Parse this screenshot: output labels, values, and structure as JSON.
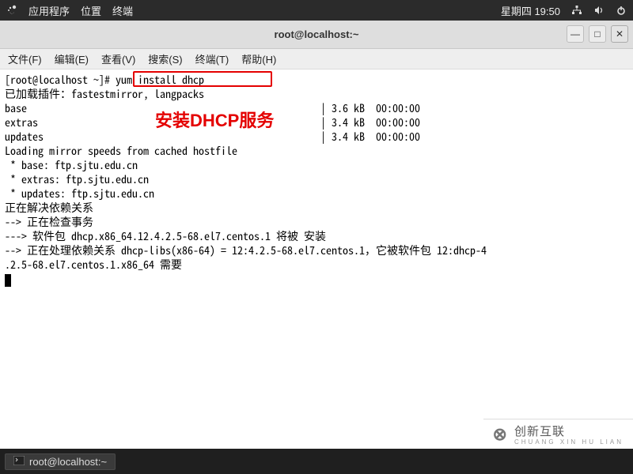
{
  "topbar": {
    "apps": "应用程序",
    "places": "位置",
    "terminal": "终端",
    "clock": "星期四 19:50"
  },
  "window": {
    "title": "root@localhost:~",
    "btn_min": "—",
    "btn_max": "□",
    "btn_close": "✕"
  },
  "menu": {
    "file": "文件(F)",
    "edit": "编辑(E)",
    "view": "查看(V)",
    "search": "搜索(S)",
    "terminal": "终端(T)",
    "help": "帮助(H)"
  },
  "term": {
    "prompt": "[root@localhost ~]# ",
    "cmd": "yum install dhcp",
    "line2": "已加载插件：fastestmirror, langpacks",
    "line3": "base                                                     | 3.6 kB  00:00:00",
    "line4": "extras                                                   | 3.4 kB  00:00:00",
    "line5": "updates                                                  | 3.4 kB  00:00:00",
    "line6": "Loading mirror speeds from cached hostfile",
    "line7": " * base: ftp.sjtu.edu.cn",
    "line8": " * extras: ftp.sjtu.edu.cn",
    "line9": " * updates: ftp.sjtu.edu.cn",
    "line10": "正在解决依赖关系",
    "line11": "--> 正在检查事务",
    "line12": "---> 软件包 dhcp.x86_64.12.4.2.5-68.el7.centos.1 将被 安装",
    "line13a": "--> 正在处理依赖关系 dhcp-libs(x86-64) = 12:4.2.5-68.el7.centos.1，它被软件包 12:dhcp-4",
    "line13b": ".2.5-68.el7.centos.1.x86_64 需要"
  },
  "annotation": {
    "text": "安装DHCP服务"
  },
  "taskbar": {
    "task1": "root@localhost:~"
  },
  "watermark": {
    "brand": "创新互联",
    "sub": "CHUANG XIN HU LIAN"
  }
}
